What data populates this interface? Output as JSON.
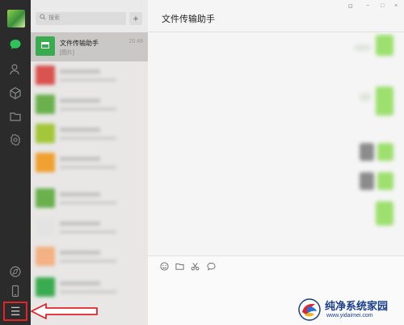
{
  "search": {
    "placeholder": "搜索",
    "add_label": "+"
  },
  "chat_list": {
    "items": [
      {
        "title": "文件传输助手",
        "preview": "[图片]",
        "time": "20:48",
        "avatar_color": "#3bab4f"
      }
    ],
    "blurred_avatar_colors": [
      "#d9534f",
      "#6ab04c",
      "#a4c639",
      "#f0a030",
      "#6ab04c",
      "#e3e3e3",
      "#f4b183",
      "#3bab4f"
    ]
  },
  "main": {
    "chat_name": "文件传输助手",
    "window_controls": [
      "⊡",
      "−",
      "□",
      "×"
    ]
  },
  "sidebar": {
    "icons": [
      "chat-icon",
      "contacts-icon",
      "favorites-icon",
      "folder-icon",
      "settings-icon",
      "moments-icon",
      "phone-icon",
      "menu-icon"
    ],
    "menu_label": "☰"
  },
  "colors": {
    "accent_green": "#2ec25a",
    "highlight_red": "#e0252a",
    "sidebar_bg": "#2b2b2c"
  },
  "watermark": {
    "title": "纯净系统家园",
    "url": "www.yidaimei.com"
  }
}
